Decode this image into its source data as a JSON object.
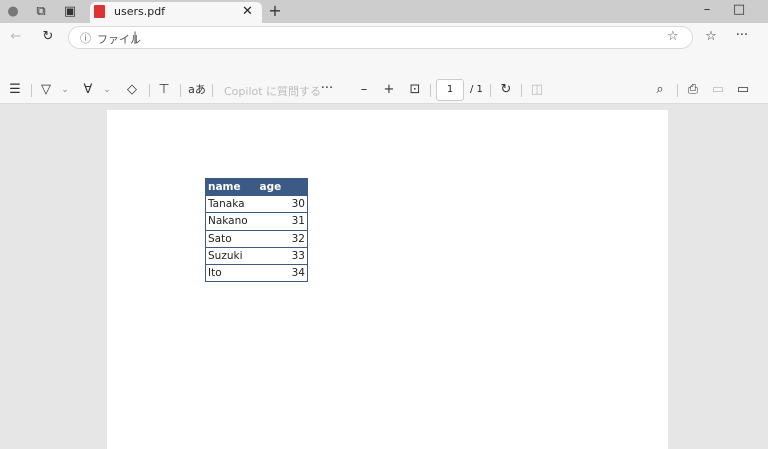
{
  "tab": {
    "title": "users.pdf"
  },
  "address": {
    "label": "ファイル",
    "value": ""
  },
  "toolbar": {
    "copilot": "Copilot に質問する",
    "page_current": "1",
    "page_total": "/ 1"
  },
  "table": {
    "headers": [
      "name",
      "age"
    ],
    "rows": [
      [
        "Tanaka",
        "30"
      ],
      [
        "Nakano",
        "31"
      ],
      [
        "Sato",
        "32"
      ],
      [
        "Suzuki",
        "33"
      ],
      [
        "Ito",
        "34"
      ]
    ]
  },
  "colors": {
    "header": "#3b5a85"
  }
}
